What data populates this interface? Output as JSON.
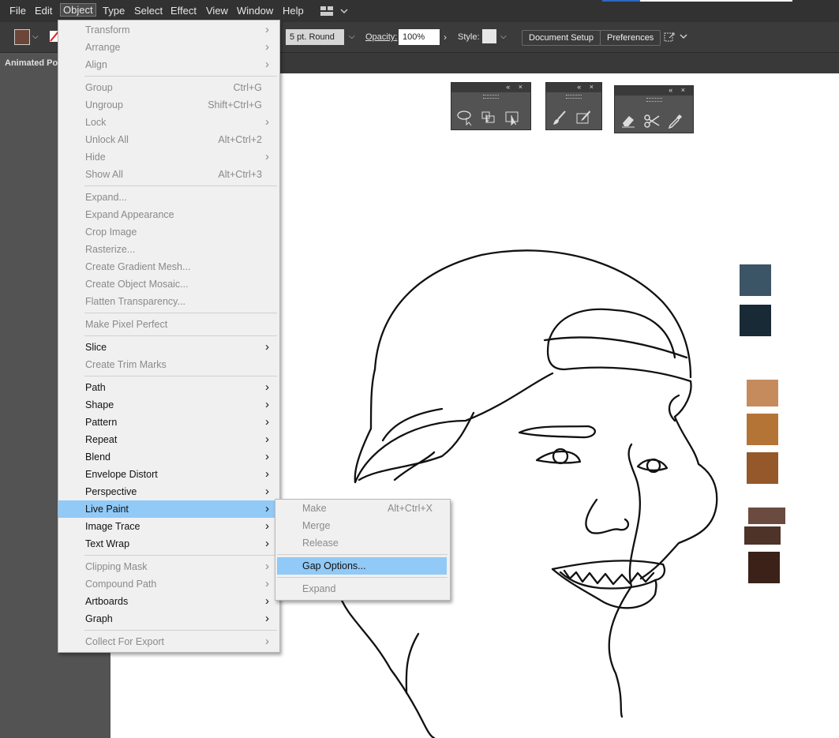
{
  "menubar": {
    "items": [
      "File",
      "Edit",
      "Object",
      "Type",
      "Select",
      "Effect",
      "View",
      "Window",
      "Help"
    ],
    "active": "Object"
  },
  "control_bar": {
    "fill_color": "#6b4639",
    "stroke_profile": "5 pt. Round",
    "opacity_label": "Opacity:",
    "opacity_value": "100%",
    "style_label": "Style:",
    "document_setup": "Document Setup",
    "preferences": "Preferences"
  },
  "document_tab": {
    "title": "Animated Po"
  },
  "object_menu": [
    {
      "label": "Transform",
      "shortcut": "",
      "submenu": true,
      "enabled": false
    },
    {
      "label": "Arrange",
      "shortcut": "",
      "submenu": true,
      "enabled": false
    },
    {
      "label": "Align",
      "shortcut": "",
      "submenu": true,
      "enabled": false
    },
    {
      "sep": true
    },
    {
      "label": "Group",
      "shortcut": "Ctrl+G",
      "submenu": false,
      "enabled": false
    },
    {
      "label": "Ungroup",
      "shortcut": "Shift+Ctrl+G",
      "submenu": false,
      "enabled": false
    },
    {
      "label": "Lock",
      "shortcut": "",
      "submenu": true,
      "enabled": false
    },
    {
      "label": "Unlock All",
      "shortcut": "Alt+Ctrl+2",
      "submenu": false,
      "enabled": false
    },
    {
      "label": "Hide",
      "shortcut": "",
      "submenu": true,
      "enabled": false
    },
    {
      "label": "Show All",
      "shortcut": "Alt+Ctrl+3",
      "submenu": false,
      "enabled": false
    },
    {
      "sep": true
    },
    {
      "label": "Expand...",
      "shortcut": "",
      "submenu": false,
      "enabled": false
    },
    {
      "label": "Expand Appearance",
      "shortcut": "",
      "submenu": false,
      "enabled": false
    },
    {
      "label": "Crop Image",
      "shortcut": "",
      "submenu": false,
      "enabled": false
    },
    {
      "label": "Rasterize...",
      "shortcut": "",
      "submenu": false,
      "enabled": false
    },
    {
      "label": "Create Gradient Mesh...",
      "shortcut": "",
      "submenu": false,
      "enabled": false
    },
    {
      "label": "Create Object Mosaic...",
      "shortcut": "",
      "submenu": false,
      "enabled": false
    },
    {
      "label": "Flatten Transparency...",
      "shortcut": "",
      "submenu": false,
      "enabled": false
    },
    {
      "sep": true
    },
    {
      "label": "Make Pixel Perfect",
      "shortcut": "",
      "submenu": false,
      "enabled": false
    },
    {
      "sep": true
    },
    {
      "label": "Slice",
      "shortcut": "",
      "submenu": true,
      "enabled": true
    },
    {
      "label": "Create Trim Marks",
      "shortcut": "",
      "submenu": false,
      "enabled": false
    },
    {
      "sep": true
    },
    {
      "label": "Path",
      "shortcut": "",
      "submenu": true,
      "enabled": true
    },
    {
      "label": "Shape",
      "shortcut": "",
      "submenu": true,
      "enabled": true
    },
    {
      "label": "Pattern",
      "shortcut": "",
      "submenu": true,
      "enabled": true
    },
    {
      "label": "Repeat",
      "shortcut": "",
      "submenu": true,
      "enabled": true
    },
    {
      "label": "Blend",
      "shortcut": "",
      "submenu": true,
      "enabled": true
    },
    {
      "label": "Envelope Distort",
      "shortcut": "",
      "submenu": true,
      "enabled": true
    },
    {
      "label": "Perspective",
      "shortcut": "",
      "submenu": true,
      "enabled": true
    },
    {
      "label": "Live Paint",
      "shortcut": "",
      "submenu": true,
      "enabled": true,
      "highlighted": true
    },
    {
      "label": "Image Trace",
      "shortcut": "",
      "submenu": true,
      "enabled": true
    },
    {
      "label": "Text Wrap",
      "shortcut": "",
      "submenu": true,
      "enabled": true
    },
    {
      "sep": true
    },
    {
      "label": "Clipping Mask",
      "shortcut": "",
      "submenu": true,
      "enabled": false
    },
    {
      "label": "Compound Path",
      "shortcut": "",
      "submenu": true,
      "enabled": false
    },
    {
      "label": "Artboards",
      "shortcut": "",
      "submenu": true,
      "enabled": true
    },
    {
      "label": "Graph",
      "shortcut": "",
      "submenu": true,
      "enabled": true
    },
    {
      "sep": true
    },
    {
      "label": "Collect For Export",
      "shortcut": "",
      "submenu": true,
      "enabled": false
    }
  ],
  "live_paint_submenu": [
    {
      "label": "Make",
      "shortcut": "Alt+Ctrl+X",
      "enabled": false
    },
    {
      "label": "Merge",
      "shortcut": "",
      "enabled": false
    },
    {
      "label": "Release",
      "shortcut": "",
      "enabled": false
    },
    {
      "sep": true
    },
    {
      "label": "Gap Options...",
      "shortcut": "",
      "enabled": true,
      "highlighted": true
    },
    {
      "sep": true
    },
    {
      "label": "Expand",
      "shortcut": "",
      "enabled": false
    }
  ],
  "floating_panels": [
    {
      "tools": [
        "lasso-select-icon",
        "group-select-icon",
        "artboard-select-icon"
      ]
    },
    {
      "tools": [
        "paintbrush-icon",
        "blob-brush-icon"
      ]
    },
    {
      "tools": [
        "eraser-icon",
        "scissors-icon",
        "eyedropper-icon"
      ]
    }
  ],
  "color_swatches": [
    "#3c5566",
    "#182a36",
    "#c68b5d",
    "#b37436",
    "#94582a",
    "#6b4a3f",
    "#4e3328",
    "#3b2118"
  ]
}
